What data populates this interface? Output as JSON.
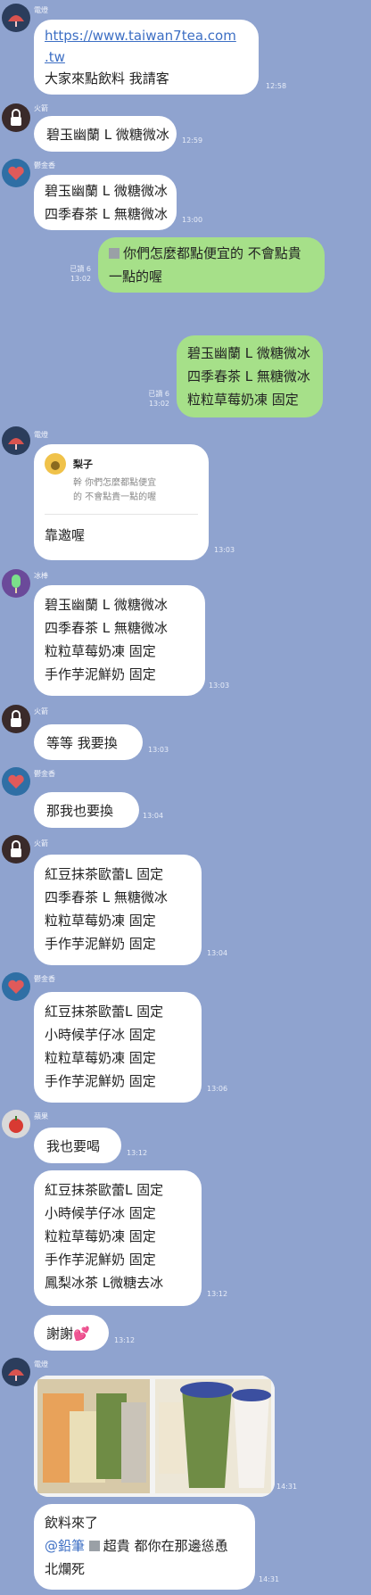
{
  "colors": {
    "background": "#8fa3cf",
    "incoming_bubble": "#ffffff",
    "outgoing_bubble": "#a6e089",
    "link": "#3d6fc4"
  },
  "messages": [
    {
      "sender": "電燈",
      "lines": [
        "https://www.taiwan7tea.com",
        ".tw",
        "大家來點飲料 我請客"
      ],
      "time": "12:58"
    },
    {
      "sender": "火箭",
      "lines": [
        "碧玉幽蘭 L 微糖微冰"
      ],
      "time": "12:59"
    },
    {
      "sender": "鬱金香",
      "lines": [
        "碧玉幽蘭 L 微糖微冰",
        "四季春茶 L 無糖微冰"
      ],
      "time": "13:00"
    },
    {
      "sender": "",
      "lines": [
        "你們怎麼都點便宜的 不會點貴",
        "一點的喔"
      ],
      "time": "13:02",
      "read": "已讀 6"
    },
    {
      "sender": "",
      "lines": [
        "碧玉幽蘭 L 微糖微冰",
        "四季春茶 L 無糖微冰",
        "粒粒草莓奶凍 固定"
      ],
      "time": "13:02",
      "read": "已讀 6"
    },
    {
      "sender": "電燈",
      "quote": {
        "name": "梨子",
        "text1": "幹 你們怎麼都點便宜",
        "text2": "的 不會點貴一點的喔"
      },
      "lines": [
        "靠邀喔"
      ],
      "time": "13:03"
    },
    {
      "sender": "冰棒",
      "lines": [
        "碧玉幽蘭 L 微糖微冰",
        "四季春茶 L 無糖微冰",
        "粒粒草莓奶凍 固定",
        "手作芋泥鮮奶 固定"
      ],
      "time": "13:03"
    },
    {
      "sender": "火箭",
      "lines": [
        "等等 我要換"
      ],
      "time": "13:03"
    },
    {
      "sender": "鬱金香",
      "lines": [
        "那我也要換"
      ],
      "time": "13:04"
    },
    {
      "sender": "火箭",
      "lines": [
        "紅豆抹茶歐蕾L 固定",
        "四季春茶 L 無糖微冰",
        "粒粒草莓奶凍 固定",
        "手作芋泥鮮奶 固定"
      ],
      "time": "13:04"
    },
    {
      "sender": "鬱金香",
      "lines": [
        "紅豆抹茶歐蕾L 固定",
        "小時候芋仔冰 固定",
        "粒粒草莓奶凍 固定",
        "手作芋泥鮮奶 固定"
      ],
      "time": "13:06"
    },
    {
      "sender": "蘋果",
      "lines": [
        "我也要喝"
      ],
      "time": "13:12"
    },
    {
      "sender": "",
      "lines": [
        "紅豆抹茶歐蕾L 固定",
        "小時候芋仔冰 固定",
        "粒粒草莓奶凍 固定",
        "手作芋泥鮮奶 固定",
        "鳳梨冰茶 L微糖去冰"
      ],
      "time": "13:12"
    },
    {
      "sender": "",
      "lines": [
        "謝謝💕"
      ],
      "time": "13:12"
    },
    {
      "sender": "電燈",
      "lines": [],
      "time": "14:31"
    },
    {
      "sender": "",
      "lines": [
        "飲料來了",
        "@鉛筆",
        "超貴 都你在那邊慫恿",
        "北爛死"
      ],
      "time": "14:31"
    }
  ]
}
